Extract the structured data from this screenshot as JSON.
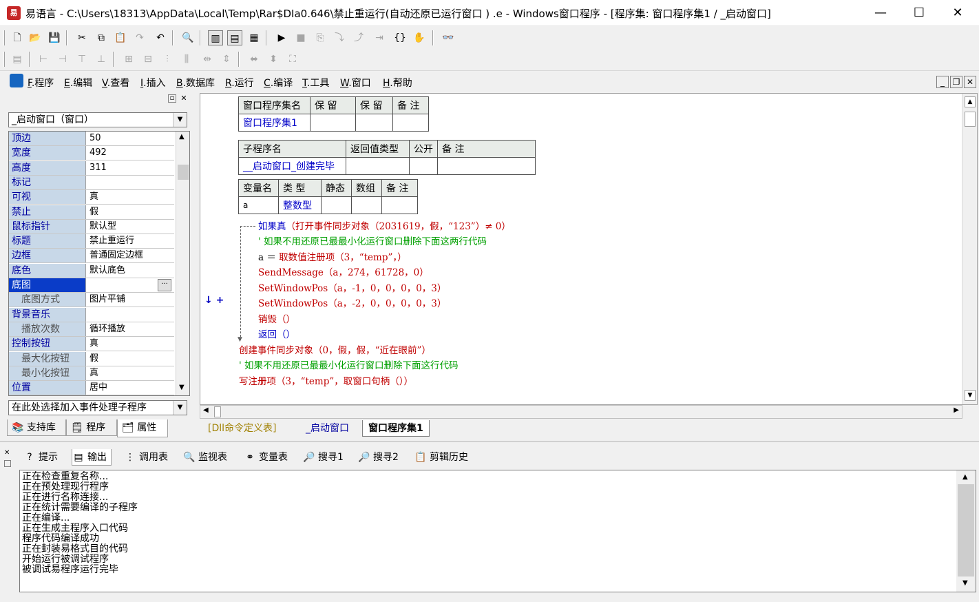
{
  "window": {
    "title": "易语言 - C:\\Users\\18313\\AppData\\Local\\Temp\\Rar$DIa0.646\\禁止重运行(自动还原已运行窗口 ) .e - Windows窗口程序 - [程序集: 窗口程序集1 / _启动窗口]",
    "minimize": "—",
    "maximize": "☐",
    "close": "✕"
  },
  "menu": [
    {
      "key": "F",
      "label": ".程序"
    },
    {
      "key": "E",
      "label": ".编辑"
    },
    {
      "key": "V",
      "label": ".查看"
    },
    {
      "key": "I",
      "label": ".插入"
    },
    {
      "key": "B",
      "label": ".数据库"
    },
    {
      "key": "R",
      "label": ".运行"
    },
    {
      "key": "C",
      "label": ".编译"
    },
    {
      "key": "T",
      "label": ".工具"
    },
    {
      "key": "W",
      "label": ".窗口"
    },
    {
      "key": "H",
      "label": ".帮助"
    }
  ],
  "left_panel": {
    "object_selector": "_启动窗口（窗口）",
    "properties": [
      {
        "name": "顶边",
        "value": "50"
      },
      {
        "name": "宽度",
        "value": "492"
      },
      {
        "name": "高度",
        "value": "311"
      },
      {
        "name": "标记",
        "value": ""
      },
      {
        "name": "可视",
        "value": "真"
      },
      {
        "name": "禁止",
        "value": "假"
      },
      {
        "name": "鼠标指针",
        "value": "默认型"
      },
      {
        "name": "标题",
        "value": "禁止重运行"
      },
      {
        "name": "边框",
        "value": "普通固定边框"
      },
      {
        "name": "底色",
        "value": "默认底色"
      },
      {
        "name": "底图",
        "value": ""
      },
      {
        "name": "底图方式",
        "value": "图片平铺"
      },
      {
        "name": "背景音乐",
        "value": ""
      },
      {
        "name": "播放次数",
        "value": "循环播放"
      },
      {
        "name": "控制按钮",
        "value": "真"
      },
      {
        "name": "最大化按钮",
        "value": "假"
      },
      {
        "name": "最小化按钮",
        "value": "真"
      },
      {
        "name": "位置",
        "value": "居中"
      }
    ],
    "event_selector": "在此处选择加入事件处理子程序",
    "tabs": [
      "支持库",
      "程序",
      "属性"
    ]
  },
  "editor": {
    "assembly_table": {
      "headers": [
        "窗口程序集名",
        "保 留",
        "保 留",
        "备 注"
      ],
      "row": [
        "窗口程序集1",
        "",
        "",
        ""
      ]
    },
    "sub_table": {
      "headers": [
        "子程序名",
        "返回值类型",
        "公开",
        "备 注"
      ],
      "row": [
        "__启动窗口_创建完毕",
        "",
        "",
        ""
      ]
    },
    "var_table": {
      "headers": [
        "变量名",
        "类 型",
        "静态",
        "数组",
        "备 注"
      ],
      "row": [
        "a",
        "整数型",
        "",
        "",
        ""
      ]
    },
    "code": {
      "l1_kw": "如果真",
      "l1_rest": "（打开事件同步对象（2031619，假，“123”）≠ 0）",
      "l2": "' 如果不用还原已最最小化运行窗口删除下面这两行代码",
      "l3_a": "a ＝ ",
      "l3_fn": "取数值注册项",
      "l3_rest": "（3，“temp”，）",
      "l4": "SendMessage（a，274，61728，0）",
      "l5": "SetWindowPos（a，-1，0，0，0，0，3）",
      "l6": "SetWindowPos（a，-2，0，0，0，0，3）",
      "l7": "销毁（）",
      "l8": "返回（）",
      "l9_fn": "创建事件同步对象",
      "l9_rest": "（0，假，假，“近在眼前”）",
      "l10": "' 如果不用还原已最最小化运行窗口删除下面这行代码",
      "l11_fn": "写注册项",
      "l11_rest": "（3，“temp”，取窗口句柄（））"
    },
    "gutter_arrow": "↓ +",
    "tabs": [
      "[Dll命令定义表]",
      "_启动窗口",
      "窗口程序集1"
    ]
  },
  "bottom": {
    "tabs": [
      "提示",
      "输出",
      "调用表",
      "监视表",
      "变量表",
      "搜寻1",
      "搜寻2",
      "剪辑历史"
    ],
    "output_lines": [
      "正在检查重复名称...",
      "正在预处理现行程序",
      "正在进行名称连接...",
      "正在统计需要编译的子程序",
      "正在编译...",
      "正在生成主程序入口代码",
      "程序代码编译成功",
      "正在封装易格式目的代码",
      "开始运行被调试程序",
      "被调试易程序运行完毕"
    ]
  }
}
